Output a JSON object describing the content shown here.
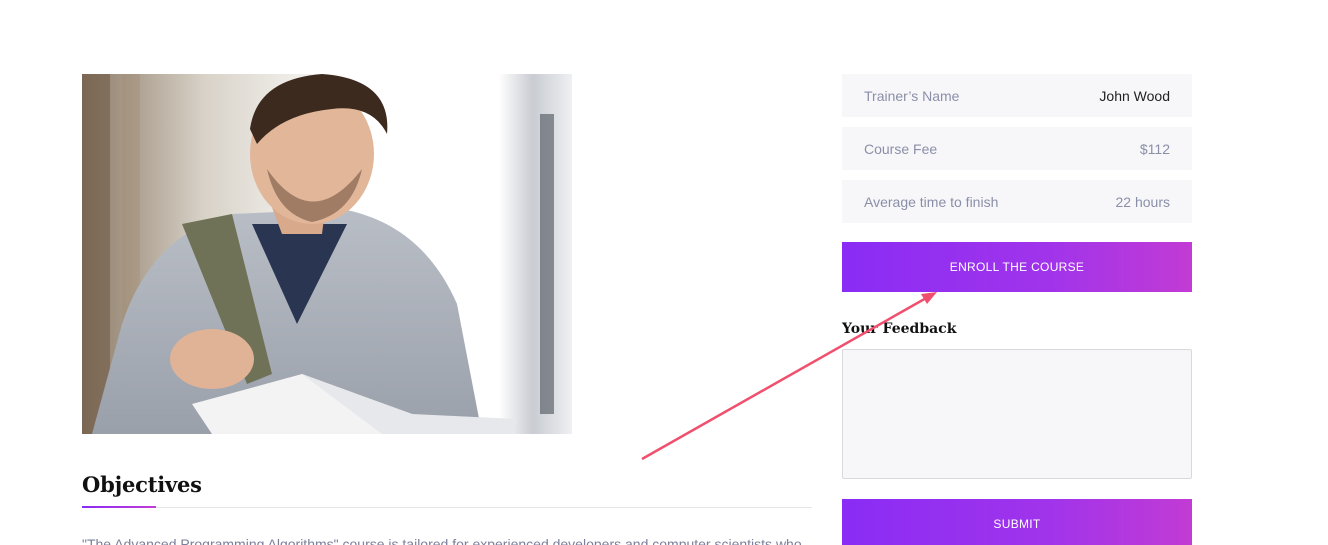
{
  "course_image": {
    "alt": "Student reading a book"
  },
  "objectives": {
    "title": "Objectives",
    "text": "\"The Advanced Programming Algorithms\" course is tailored for experienced developers and computer scientists who"
  },
  "info": [
    {
      "label": "Trainer’s Name",
      "value": "John Wood"
    },
    {
      "label": "Course Fee",
      "value": "$112"
    },
    {
      "label": "Average time to finish",
      "value": "22 hours"
    }
  ],
  "enroll_button": "ENROLL THE COURSE",
  "feedback": {
    "label": "Your Feedback",
    "value": "",
    "placeholder": ""
  },
  "submit_button": "SUBMIT",
  "colors": {
    "accent_start": "#8a2cf5",
    "accent_end": "#c23bd4",
    "annotation_arrow": "#f0506e"
  }
}
